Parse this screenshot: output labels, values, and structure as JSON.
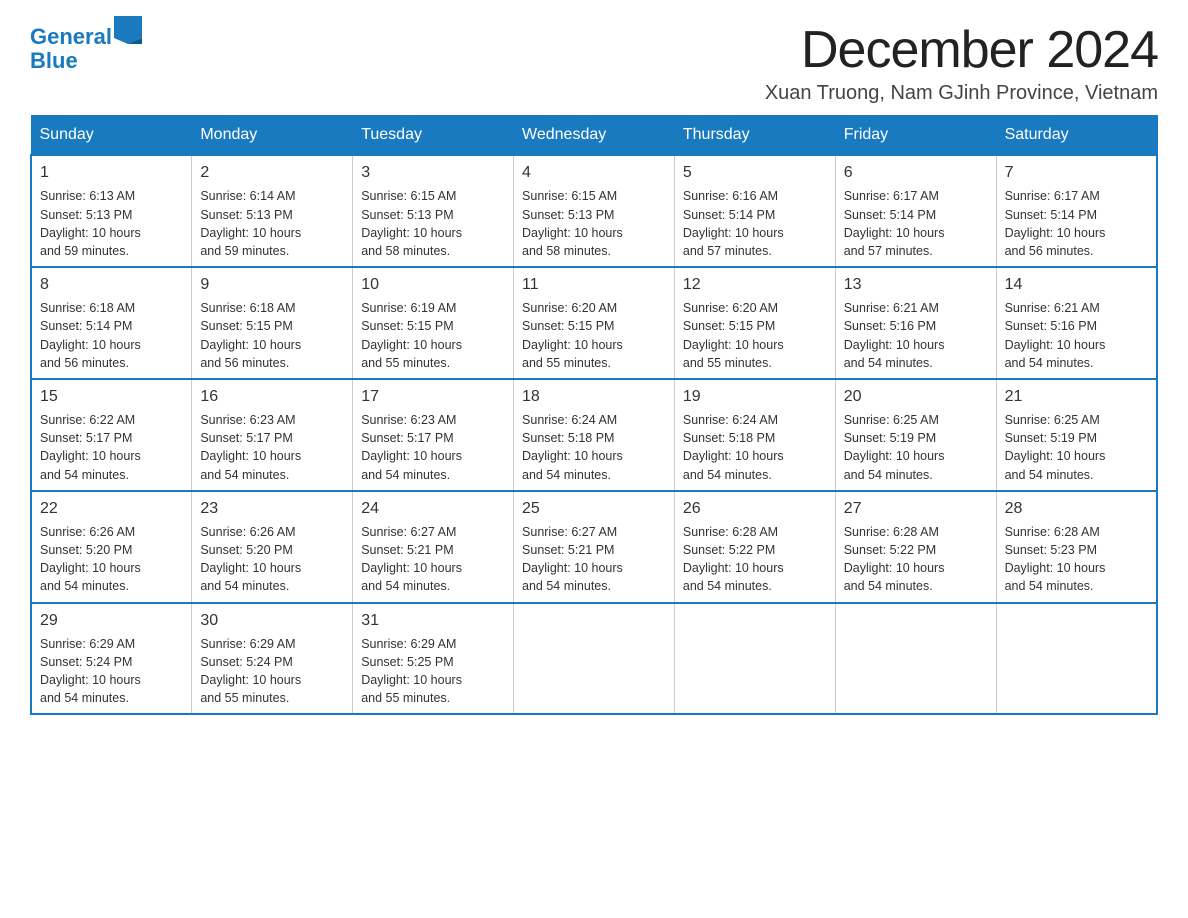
{
  "header": {
    "logo_text_general": "General",
    "logo_text_blue": "Blue",
    "main_title": "December 2024",
    "subtitle": "Xuan Truong, Nam GJinh Province, Vietnam"
  },
  "days_of_week": [
    "Sunday",
    "Monday",
    "Tuesday",
    "Wednesday",
    "Thursday",
    "Friday",
    "Saturday"
  ],
  "weeks": [
    [
      {
        "day": "1",
        "sunrise": "6:13 AM",
        "sunset": "5:13 PM",
        "daylight": "10 hours and 59 minutes."
      },
      {
        "day": "2",
        "sunrise": "6:14 AM",
        "sunset": "5:13 PM",
        "daylight": "10 hours and 59 minutes."
      },
      {
        "day": "3",
        "sunrise": "6:15 AM",
        "sunset": "5:13 PM",
        "daylight": "10 hours and 58 minutes."
      },
      {
        "day": "4",
        "sunrise": "6:15 AM",
        "sunset": "5:13 PM",
        "daylight": "10 hours and 58 minutes."
      },
      {
        "day": "5",
        "sunrise": "6:16 AM",
        "sunset": "5:14 PM",
        "daylight": "10 hours and 57 minutes."
      },
      {
        "day": "6",
        "sunrise": "6:17 AM",
        "sunset": "5:14 PM",
        "daylight": "10 hours and 57 minutes."
      },
      {
        "day": "7",
        "sunrise": "6:17 AM",
        "sunset": "5:14 PM",
        "daylight": "10 hours and 56 minutes."
      }
    ],
    [
      {
        "day": "8",
        "sunrise": "6:18 AM",
        "sunset": "5:14 PM",
        "daylight": "10 hours and 56 minutes."
      },
      {
        "day": "9",
        "sunrise": "6:18 AM",
        "sunset": "5:15 PM",
        "daylight": "10 hours and 56 minutes."
      },
      {
        "day": "10",
        "sunrise": "6:19 AM",
        "sunset": "5:15 PM",
        "daylight": "10 hours and 55 minutes."
      },
      {
        "day": "11",
        "sunrise": "6:20 AM",
        "sunset": "5:15 PM",
        "daylight": "10 hours and 55 minutes."
      },
      {
        "day": "12",
        "sunrise": "6:20 AM",
        "sunset": "5:15 PM",
        "daylight": "10 hours and 55 minutes."
      },
      {
        "day": "13",
        "sunrise": "6:21 AM",
        "sunset": "5:16 PM",
        "daylight": "10 hours and 54 minutes."
      },
      {
        "day": "14",
        "sunrise": "6:21 AM",
        "sunset": "5:16 PM",
        "daylight": "10 hours and 54 minutes."
      }
    ],
    [
      {
        "day": "15",
        "sunrise": "6:22 AM",
        "sunset": "5:17 PM",
        "daylight": "10 hours and 54 minutes."
      },
      {
        "day": "16",
        "sunrise": "6:23 AM",
        "sunset": "5:17 PM",
        "daylight": "10 hours and 54 minutes."
      },
      {
        "day": "17",
        "sunrise": "6:23 AM",
        "sunset": "5:17 PM",
        "daylight": "10 hours and 54 minutes."
      },
      {
        "day": "18",
        "sunrise": "6:24 AM",
        "sunset": "5:18 PM",
        "daylight": "10 hours and 54 minutes."
      },
      {
        "day": "19",
        "sunrise": "6:24 AM",
        "sunset": "5:18 PM",
        "daylight": "10 hours and 54 minutes."
      },
      {
        "day": "20",
        "sunrise": "6:25 AM",
        "sunset": "5:19 PM",
        "daylight": "10 hours and 54 minutes."
      },
      {
        "day": "21",
        "sunrise": "6:25 AM",
        "sunset": "5:19 PM",
        "daylight": "10 hours and 54 minutes."
      }
    ],
    [
      {
        "day": "22",
        "sunrise": "6:26 AM",
        "sunset": "5:20 PM",
        "daylight": "10 hours and 54 minutes."
      },
      {
        "day": "23",
        "sunrise": "6:26 AM",
        "sunset": "5:20 PM",
        "daylight": "10 hours and 54 minutes."
      },
      {
        "day": "24",
        "sunrise": "6:27 AM",
        "sunset": "5:21 PM",
        "daylight": "10 hours and 54 minutes."
      },
      {
        "day": "25",
        "sunrise": "6:27 AM",
        "sunset": "5:21 PM",
        "daylight": "10 hours and 54 minutes."
      },
      {
        "day": "26",
        "sunrise": "6:28 AM",
        "sunset": "5:22 PM",
        "daylight": "10 hours and 54 minutes."
      },
      {
        "day": "27",
        "sunrise": "6:28 AM",
        "sunset": "5:22 PM",
        "daylight": "10 hours and 54 minutes."
      },
      {
        "day": "28",
        "sunrise": "6:28 AM",
        "sunset": "5:23 PM",
        "daylight": "10 hours and 54 minutes."
      }
    ],
    [
      {
        "day": "29",
        "sunrise": "6:29 AM",
        "sunset": "5:24 PM",
        "daylight": "10 hours and 54 minutes."
      },
      {
        "day": "30",
        "sunrise": "6:29 AM",
        "sunset": "5:24 PM",
        "daylight": "10 hours and 55 minutes."
      },
      {
        "day": "31",
        "sunrise": "6:29 AM",
        "sunset": "5:25 PM",
        "daylight": "10 hours and 55 minutes."
      },
      null,
      null,
      null,
      null
    ]
  ],
  "labels": {
    "sunrise_prefix": "Sunrise: ",
    "sunset_prefix": "Sunset: ",
    "daylight_prefix": "Daylight: "
  }
}
